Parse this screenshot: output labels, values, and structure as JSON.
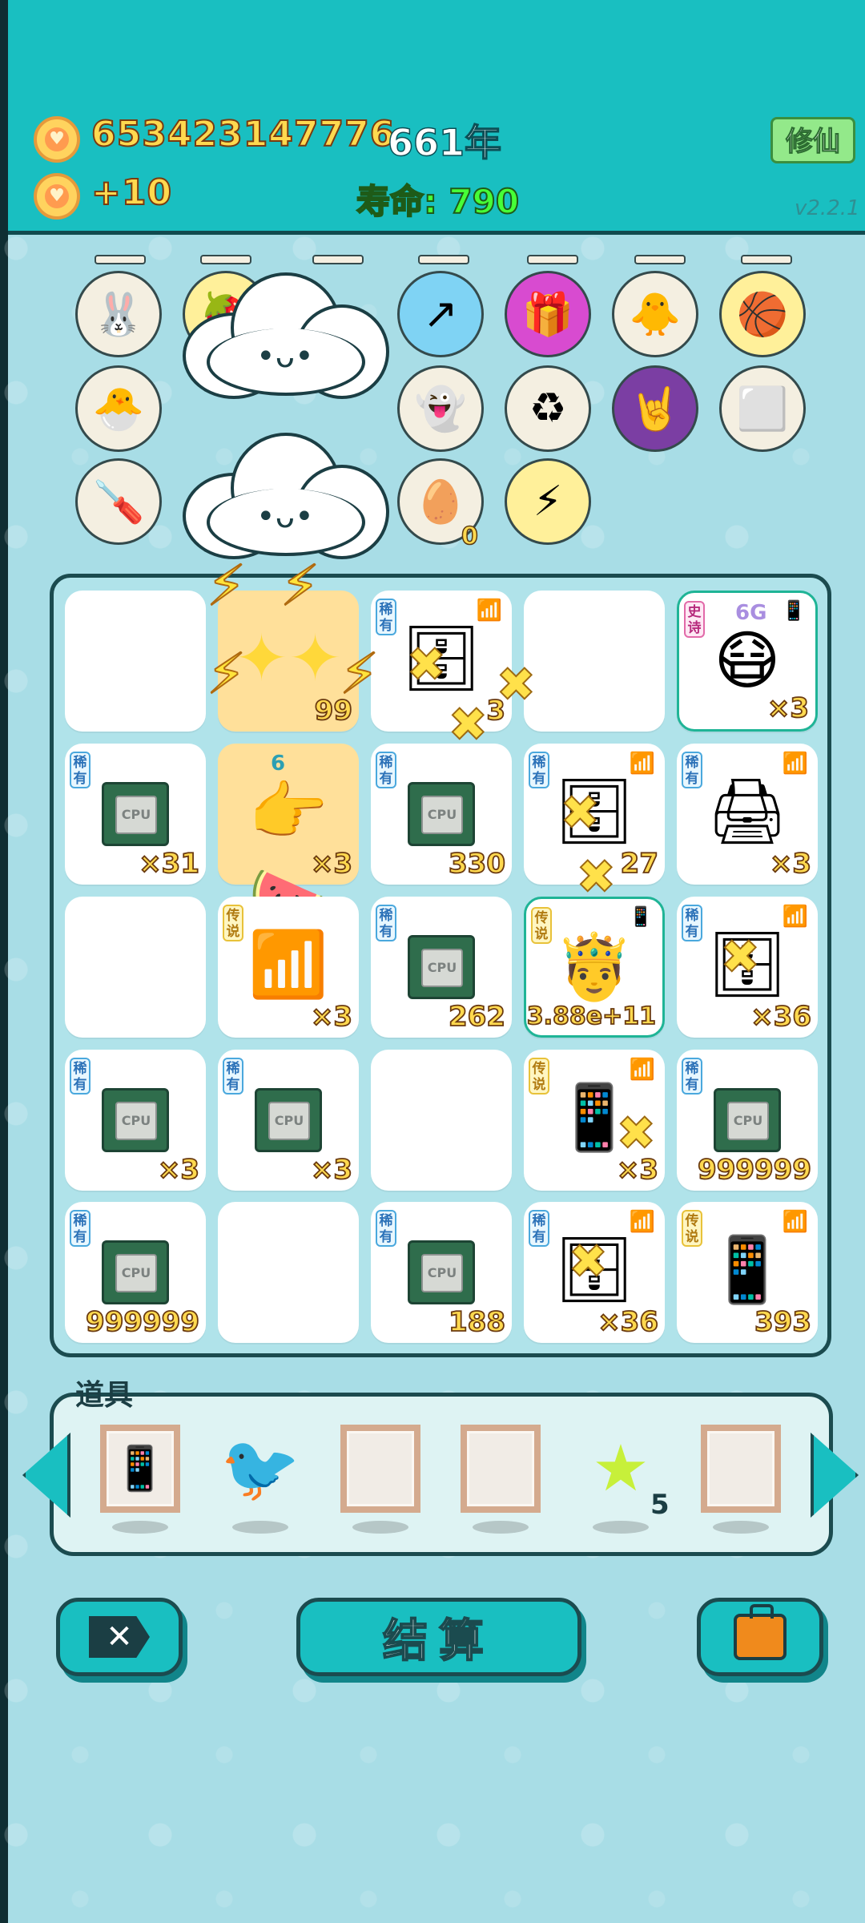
{
  "header": {
    "coins": "653423147776",
    "years": "661年",
    "income": "+10",
    "lifespan": "寿命: 790",
    "cultivate_label": "修仙",
    "version": "v2.2.1"
  },
  "buffs": {
    "row1": [
      "rabbit-icon",
      "fruit-icon",
      "cloud-icon",
      "arrow-icon",
      "gift-icon",
      "chick-icon",
      "basketballs-icon"
    ],
    "row2": [
      "chick-egg-icon",
      "ghost-icon",
      "recycle-icon",
      "rock-hand-icon",
      "cubes-icon"
    ],
    "row3": [
      "screwdriver-icon",
      "egg-tray-icon",
      "lightning-icon"
    ],
    "egg_tray_count": "0"
  },
  "board": {
    "cells": [
      {
        "qty": "",
        "tag": "",
        "icon": ""
      },
      {
        "qty": "99",
        "tag": "",
        "icon": "stars-burst"
      },
      {
        "qty": "3",
        "tag": "稀有",
        "icon": "server-icon"
      },
      {
        "qty": "",
        "tag": "",
        "icon": ""
      },
      {
        "qty": "×3",
        "tag": "史诗",
        "icon": "face-icon",
        "net": "6G"
      },
      {
        "qty": "×31",
        "tag": "稀有",
        "icon": "cpu"
      },
      {
        "qty": "×3",
        "tag": "",
        "icon": "hand-watermelon-icon",
        "net": "6"
      },
      {
        "qty": "330",
        "tag": "稀有",
        "icon": "cpu"
      },
      {
        "qty": "27",
        "tag": "稀有",
        "icon": "server-icon"
      },
      {
        "qty": "×3",
        "tag": "稀有",
        "icon": "printer-icon"
      },
      {
        "qty": "",
        "tag": "",
        "icon": ""
      },
      {
        "qty": "×3",
        "tag": "传说",
        "icon": "wifi-icon"
      },
      {
        "qty": "262",
        "tag": "稀有",
        "icon": "cpu"
      },
      {
        "qty": "3.88e+11",
        "tag": "传说",
        "icon": "king-icon"
      },
      {
        "qty": "×36",
        "tag": "稀有",
        "icon": "server-icon"
      },
      {
        "qty": "×3",
        "tag": "稀有",
        "icon": "cpu"
      },
      {
        "qty": "×3",
        "tag": "稀有",
        "icon": "cpu"
      },
      {
        "qty": "",
        "tag": "",
        "icon": ""
      },
      {
        "qty": "×3",
        "tag": "传说",
        "icon": "smartphone-icon"
      },
      {
        "qty": "999999",
        "tag": "稀有",
        "icon": "cpu"
      },
      {
        "qty": "999999",
        "tag": "稀有",
        "icon": "cpu"
      },
      {
        "qty": "",
        "tag": "",
        "icon": ""
      },
      {
        "qty": "188",
        "tag": "稀有",
        "icon": "cpu"
      },
      {
        "qty": "×36",
        "tag": "稀有",
        "icon": "server-icon"
      },
      {
        "qty": "393",
        "tag": "传说",
        "icon": "smartphone-icon"
      }
    ],
    "cpu_label": "CPU"
  },
  "toolbar": {
    "title": "道具",
    "items": [
      "phone-frame-icon",
      "white-bird-icon",
      "empty-frame",
      "empty-frame",
      "star-icon",
      "empty-frame"
    ],
    "star_count": "5"
  },
  "actions": {
    "settle_label": "结算"
  },
  "colors": {
    "header_bg": "#19bfc1",
    "page_bg": "#a8dde6",
    "coin_text": "#ffd94f",
    "life_text": "#46ff37"
  }
}
